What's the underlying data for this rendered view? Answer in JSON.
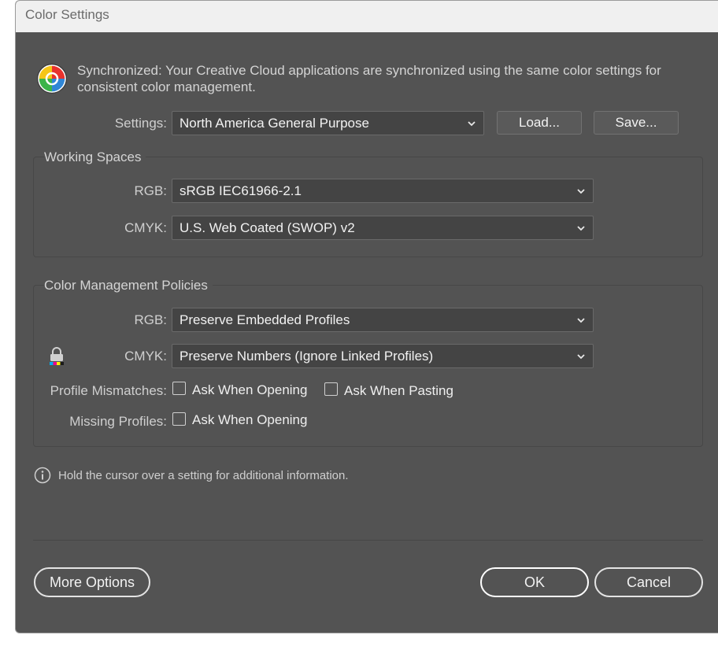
{
  "window": {
    "title": "Color Settings"
  },
  "sync": {
    "message": "Synchronized: Your Creative Cloud applications are synchronized using the same color settings for consistent color management."
  },
  "settings": {
    "label": "Settings:",
    "value": "North America General Purpose",
    "load_label": "Load...",
    "save_label": "Save..."
  },
  "working_spaces": {
    "title": "Working Spaces",
    "rgb": {
      "label": "RGB:",
      "value": "sRGB IEC61966-2.1"
    },
    "cmyk": {
      "label": "CMYK:",
      "value": "U.S. Web Coated (SWOP) v2"
    }
  },
  "policies": {
    "title": "Color Management Policies",
    "rgb": {
      "label": "RGB:",
      "value": "Preserve Embedded Profiles"
    },
    "cmyk": {
      "label": "CMYK:",
      "value": "Preserve Numbers (Ignore Linked Profiles)"
    },
    "profile_mismatches": {
      "label": "Profile Mismatches:",
      "ask_opening": {
        "label": "Ask When Opening",
        "checked": false
      },
      "ask_pasting": {
        "label": "Ask When Pasting",
        "checked": false
      }
    },
    "missing_profiles": {
      "label": "Missing Profiles:",
      "ask_opening": {
        "label": "Ask When Opening",
        "checked": false
      }
    }
  },
  "hint": {
    "text": "Hold the cursor over a setting for additional information."
  },
  "buttons": {
    "more_options": "More Options",
    "ok": "OK",
    "cancel": "Cancel"
  },
  "colors": {
    "dialog_bg": "#535353",
    "control_bg": "#444444",
    "titlebar_bg": "#f0f0f0"
  }
}
